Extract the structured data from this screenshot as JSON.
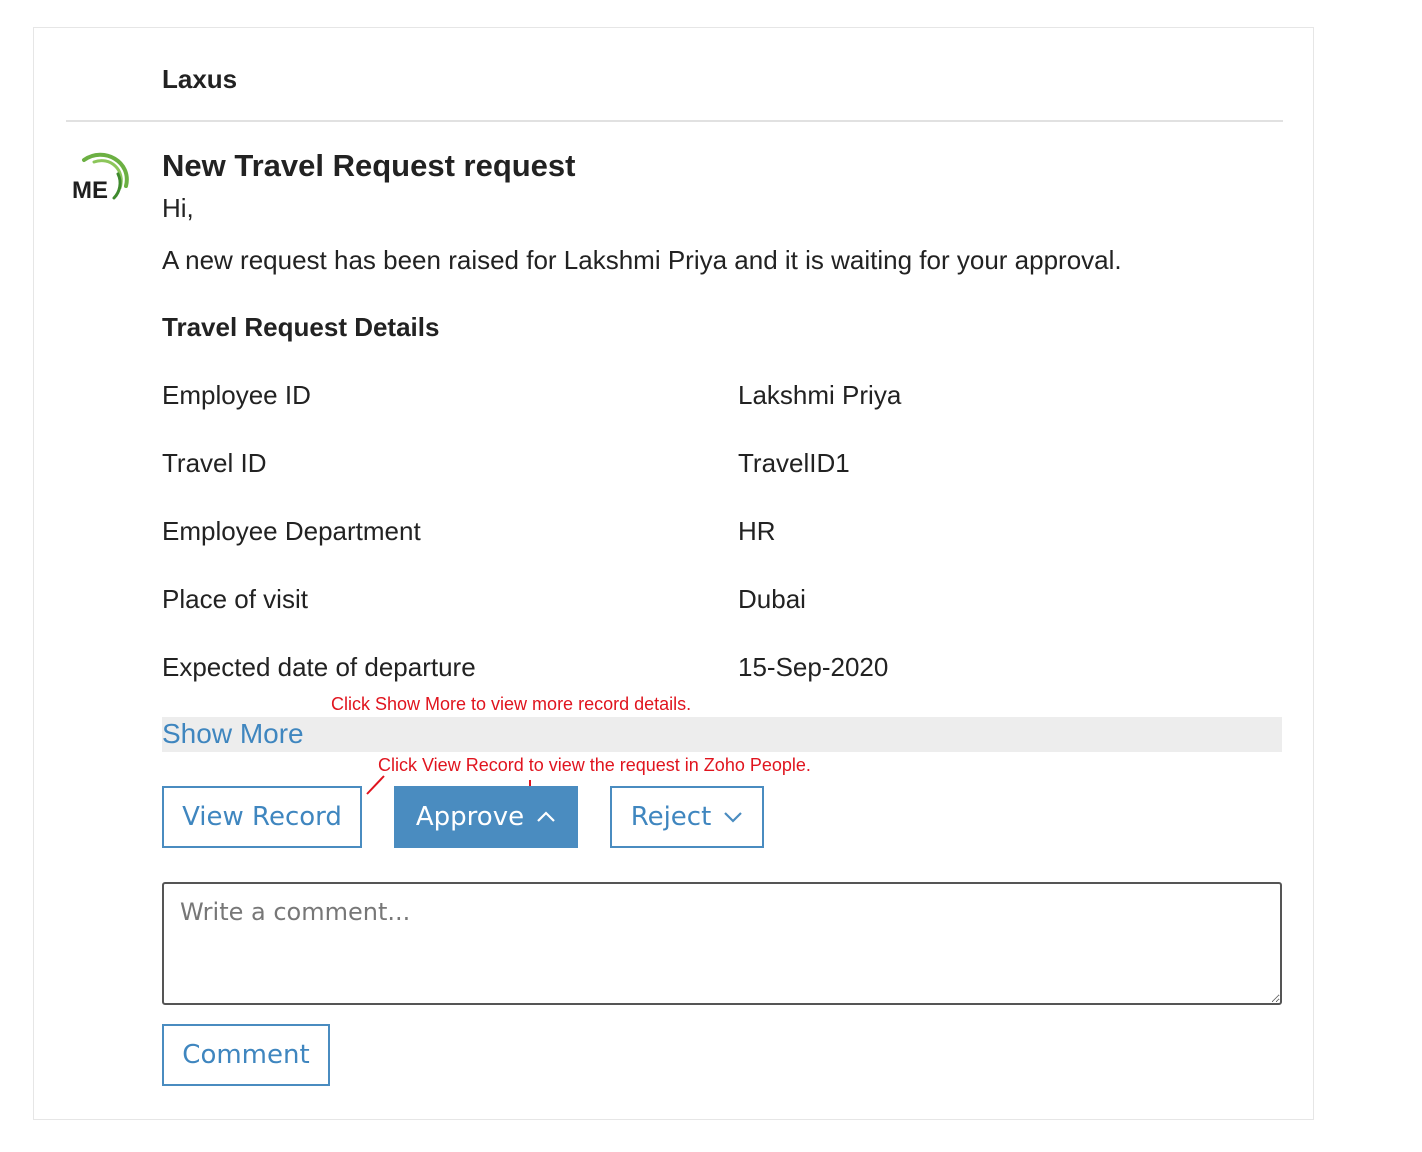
{
  "header": {
    "sender": "Laxus"
  },
  "logo": {
    "text": "ME",
    "accent": "#6cb043"
  },
  "message": {
    "title": "New Travel Request request",
    "greeting": "Hi,",
    "body": "A new request has been raised for Lakshmi Priya and it is waiting for your approval."
  },
  "details": {
    "section_title": "Travel Request Details",
    "rows": [
      {
        "label": "Employee ID",
        "value": "Lakshmi Priya"
      },
      {
        "label": "Travel ID",
        "value": "TravelID1"
      },
      {
        "label": "Employee Department",
        "value": "HR"
      },
      {
        "label": "Place of visit",
        "value": "Dubai"
      },
      {
        "label": "Expected date of departure",
        "value": "15-Sep-2020"
      }
    ]
  },
  "show_more": {
    "label": "Show More"
  },
  "annotations": {
    "show_more": "Click Show More to view more record details.",
    "view_record": "Click View Record to view the request in Zoho People."
  },
  "actions": {
    "view_record": "View Record",
    "approve": "Approve",
    "reject": "Reject"
  },
  "comment": {
    "placeholder": "Write a comment...",
    "button": "Comment"
  },
  "colors": {
    "accent": "#4a8cc0",
    "link": "#3f86bf",
    "annotation": "#e0141e"
  }
}
